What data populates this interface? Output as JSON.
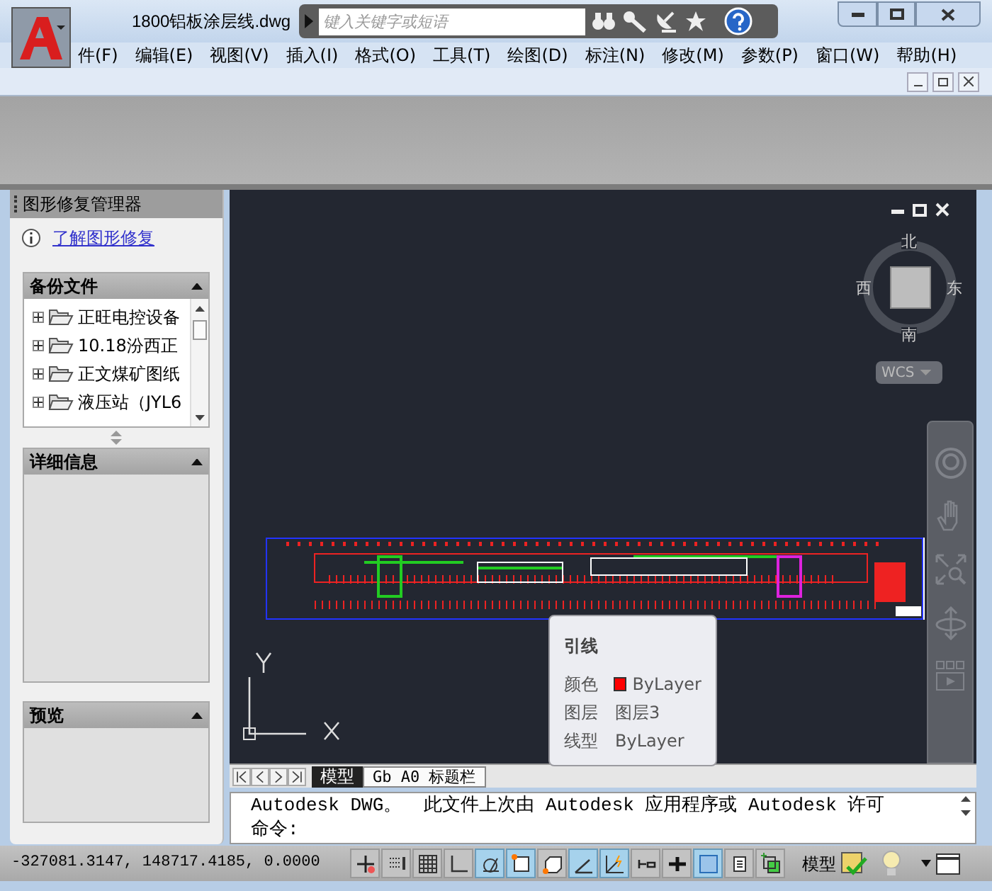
{
  "title_bar": {
    "file_name": "1800铝板涂层线.dwg",
    "search": {
      "placeholder": "键入关键字或短语"
    }
  },
  "menu": [
    "件(F)",
    "编辑(E)",
    "视图(V)",
    "插入(I)",
    "格式(O)",
    "工具(T)",
    "绘图(D)",
    "标注(N)",
    "修改(M)",
    "参数(P)",
    "窗口(W)",
    "帮助(H)"
  ],
  "recovery_panel": {
    "title": "图形修复管理器",
    "link": "了解图形修复",
    "backup_section": {
      "title": "备份文件",
      "files": [
        "正旺电控设备",
        "10.18汾西正",
        "正文煤矿图纸",
        "液压站（JYL6"
      ]
    },
    "details_section": {
      "title": "详细信息"
    },
    "preview_section": {
      "title": "预览"
    }
  },
  "viewcube": {
    "north": "北",
    "south": "南",
    "west": "西",
    "east": "东",
    "coordinate_system": "WCS"
  },
  "tooltip": {
    "title": "引线",
    "rows": [
      {
        "label": "颜色",
        "value": "ByLayer",
        "color": "#ff0000"
      },
      {
        "label": "图层",
        "value": "图层3"
      },
      {
        "label": "线型",
        "value": "ByLayer"
      }
    ]
  },
  "layout_tabs": [
    {
      "label": "模型",
      "selected": true
    },
    {
      "label": "Gb A0 标题栏",
      "selected": false
    }
  ],
  "command_line": {
    "history": "Autodesk DWG。  此文件上次由 Autodesk 应用程序或 Autodesk 许可",
    "prompt": "命令:"
  },
  "status_bar": {
    "coordinates": "-327081.3147, 148717.4185, 0.0000",
    "toggles": [
      {
        "kind": "infer",
        "on": false
      },
      {
        "kind": "snap",
        "on": false
      },
      {
        "kind": "grid",
        "on": false
      },
      {
        "kind": "ortho",
        "on": false
      },
      {
        "kind": "polar",
        "on": true
      },
      {
        "kind": "osnap",
        "on": true
      },
      {
        "kind": "osnap3d",
        "on": false
      },
      {
        "kind": "otrack",
        "on": true
      },
      {
        "kind": "ducs",
        "on": true
      },
      {
        "kind": "dyn",
        "on": false
      },
      {
        "kind": "lwt",
        "on": false
      },
      {
        "kind": "tpy",
        "on": true
      },
      {
        "kind": "qp",
        "on": false
      },
      {
        "kind": "sc",
        "on": false
      }
    ],
    "space": "模型"
  }
}
